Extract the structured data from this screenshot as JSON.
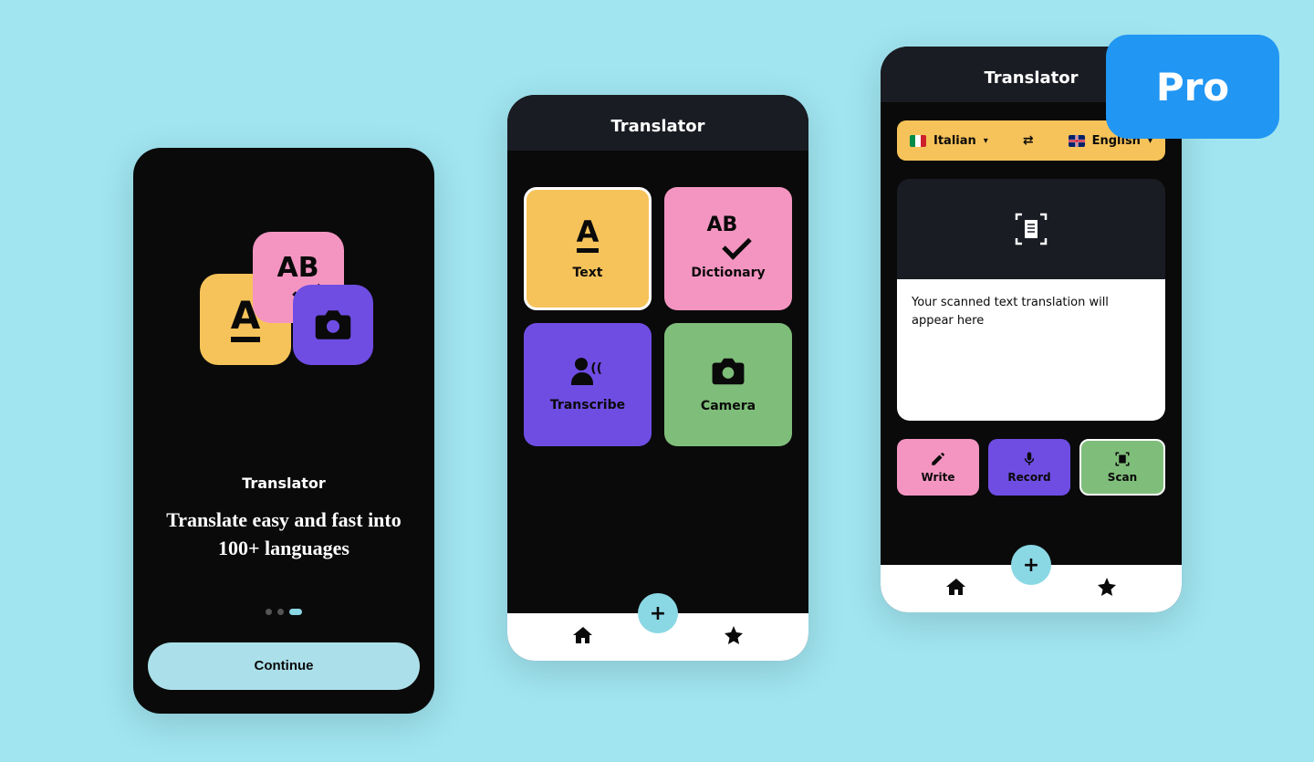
{
  "badge": {
    "label": "Pro"
  },
  "screen1": {
    "title": "Translator",
    "headline": "Translate easy and fast into 100+ languages",
    "continue_label": "Continue"
  },
  "screen2": {
    "header_title": "Translator",
    "tiles": {
      "text": "Text",
      "dictionary": "Dictionary",
      "transcribe": "Transcribe",
      "camera": "Camera"
    }
  },
  "screen3": {
    "header_title": "Translator",
    "lang_from": "Italian",
    "lang_to": "English",
    "placeholder": "Your scanned text translation will appear here",
    "actions": {
      "write": "Write",
      "record": "Record",
      "scan": "Scan"
    }
  }
}
